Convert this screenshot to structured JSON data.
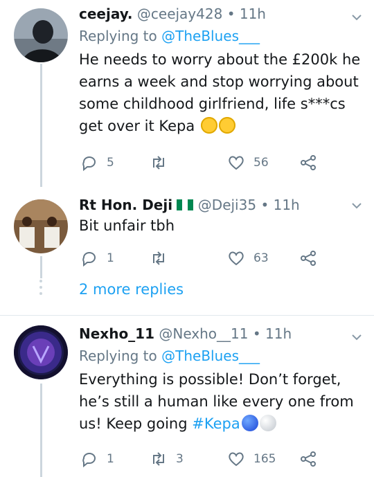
{
  "tweets": [
    {
      "name": "ceejay.",
      "handle": "@ceejay428",
      "time": "11h",
      "replying_label": "Replying to",
      "replying_to": "@TheBlues___",
      "text": "He needs to worry about the £200k he earns a week and stop worrying about some childhood girlfriend, life s***cs get over it Kepa",
      "emojis": [
        "grimacing-face",
        "grimacing-face"
      ],
      "reply_count": "5",
      "retweet_count": "",
      "like_count": "56"
    },
    {
      "name": "Rt Hon. Deji",
      "flag": "nigeria-flag",
      "handle": "@Deji35",
      "time": "11h",
      "text": "Bit unfair tbh",
      "reply_count": "1",
      "retweet_count": "",
      "like_count": "63"
    },
    {
      "name": "Nexho_11",
      "handle": "@Nexho__11",
      "time": "11h",
      "replying_label": "Replying to",
      "replying_to": "@TheBlues___",
      "text": "Everything is possible! Don’t forget, he’s still a human like every one from us! Keep going",
      "hashtag": "#Kepa",
      "emojis": [
        "blue-circle",
        "white-circle"
      ],
      "reply_count": "1",
      "retweet_count": "3",
      "like_count": "165"
    }
  ],
  "more_replies": "2 more replies",
  "colors": {
    "link": "#1da1f2",
    "muted": "#657786",
    "line": "#ccd6dd"
  },
  "sep": "•"
}
